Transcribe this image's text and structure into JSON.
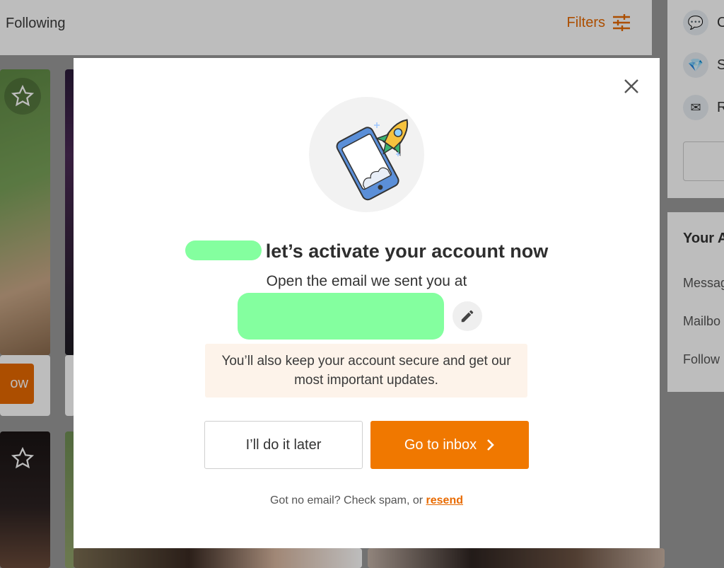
{
  "background": {
    "header": {
      "tab_label": "Following",
      "filters_label": "Filters"
    },
    "card": {
      "follow_button_label": "ow"
    },
    "sidebar": {
      "items": [
        {
          "icon": "chat-bubble-icon",
          "label": "C"
        },
        {
          "icon": "diamond-icon",
          "label": "S"
        },
        {
          "icon": "envelope-icon",
          "label": "R"
        }
      ],
      "section_title": "Your A",
      "links": [
        "Messag",
        "Mailbo",
        "Follow"
      ]
    }
  },
  "modal": {
    "illustration": "phone-rocket-illustration",
    "headline": "let’s activate your account now",
    "subline": "Open the email we sent you at",
    "notice": "You’ll also keep your account secure and get our most important updates.",
    "later_button": "I’ll do it later",
    "inbox_button": "Go to inbox",
    "footnote_prefix": "Got no email? Check spam, or",
    "resend_link": "resend"
  },
  "colors": {
    "accent": "#f07800",
    "notice_bg": "#fdf3ea",
    "redaction": "#84ff9f"
  }
}
